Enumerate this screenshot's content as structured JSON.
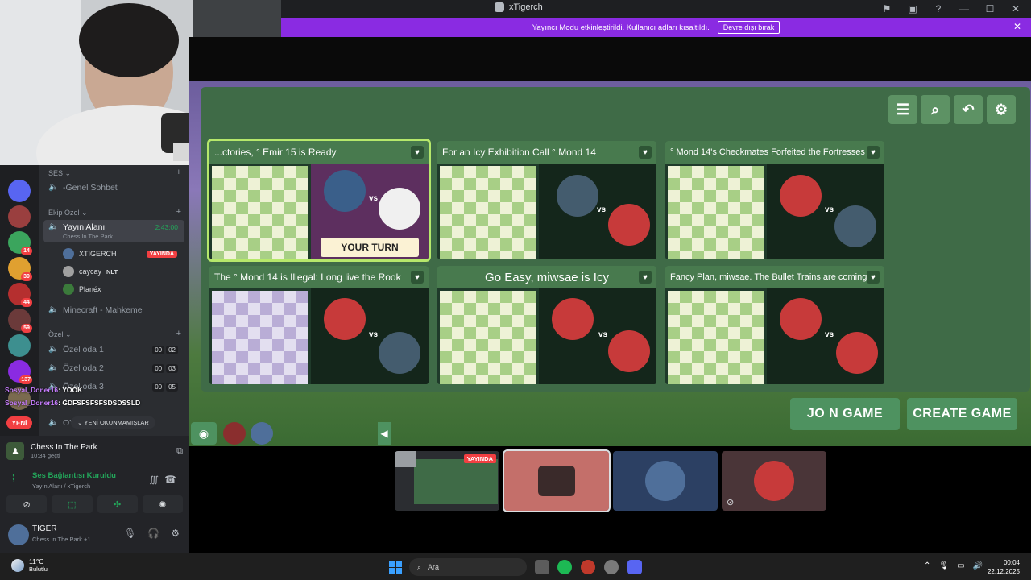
{
  "window": {
    "title": "xTigerch"
  },
  "banner": {
    "message": "Yayıncı Modu etkinleştirildi. Kullanıcı adları kısaltıldı.",
    "button": "Devre dışı bırak",
    "close": "✕"
  },
  "sidebar": {
    "categories": {
      "ses": "SES",
      "ekip": "Ekip Özel",
      "ozel": "Özel"
    },
    "channels": {
      "genel": "-Genel Sohbet",
      "yayin": "Yayın Alanı",
      "yayin_time": "2:43:00",
      "yayin_activity": "Chess In The Park",
      "minecraft": "Minecraft - Mahkeme",
      "oda1": "Özel oda 1",
      "oda1_counts": [
        "00",
        "02"
      ],
      "oda2": "Özel oda 2",
      "oda2_counts": [
        "00",
        "03"
      ],
      "oda3": "Özel oda 3",
      "oda3_counts": [
        "00",
        "05"
      ],
      "oda4": "OY..."
    },
    "voice_users": [
      {
        "name": "XTIGERCH",
        "tag": "YAYINDA"
      },
      {
        "name": "caycay",
        "tag": "NLT"
      },
      {
        "name": "Planéx",
        "tag": ""
      }
    ],
    "chat_overlay": [
      {
        "nick": "Sosyal_Doner16",
        "text": ": YOOK"
      },
      {
        "nick": "Sosyal_Doner16",
        "text": ": ĞDFSFSFSFSDSDSSLD"
      }
    ],
    "new_pill": "YENİ",
    "new_messages": "YENİ OKUNMAMIŞLAR",
    "server_badges": [
      "14",
      "39",
      "44",
      "59",
      "137"
    ]
  },
  "status_panel": {
    "activity_title": "Chess In The Park",
    "activity_sub": "10:34 geçti",
    "voice_title": "Ses Bağlantısı Kuruldu",
    "voice_sub": "Yayın Alanı / xTigerch",
    "user_name": "TIGER",
    "user_sub": "Chess In The Park +1"
  },
  "game": {
    "cards": [
      {
        "title": "...ctories, ° Emir 15 is Ready",
        "your_turn": "YOUR TURN",
        "vs": "vs"
      },
      {
        "title": "For an Icy Exhibition Call ° Mond 14",
        "vs": "vs"
      },
      {
        "title": "° Mond 14's Checkmates Forfeited the Fortresses",
        "vs": "vs"
      },
      {
        "title": "The ° Mond 14 is Illegal: Long live the Rook",
        "vs": "vs"
      },
      {
        "title": "Go Easy, miwsae is Icy",
        "vs": "vs"
      },
      {
        "title": "Fancy Plan, miwsae. The Bullet Trains are coming",
        "vs": "vs"
      }
    ],
    "join_button": "JO N GAME",
    "create_button": "CREATE GAME",
    "tools": [
      "filter-icon",
      "search-icon",
      "undo-icon",
      "settings-icon"
    ]
  },
  "thumbnails": {
    "live_badge": "YAYINDA"
  },
  "taskbar": {
    "temp": "11°C",
    "condition": "Bulutlu",
    "search_placeholder": "Ara",
    "time": "00:04",
    "date": "22.12.2025"
  },
  "colors": {
    "accent_purple": "#8a2be2",
    "discord_green": "#23a55a",
    "game_green": "#4e9260",
    "live_red": "#f23f42"
  }
}
